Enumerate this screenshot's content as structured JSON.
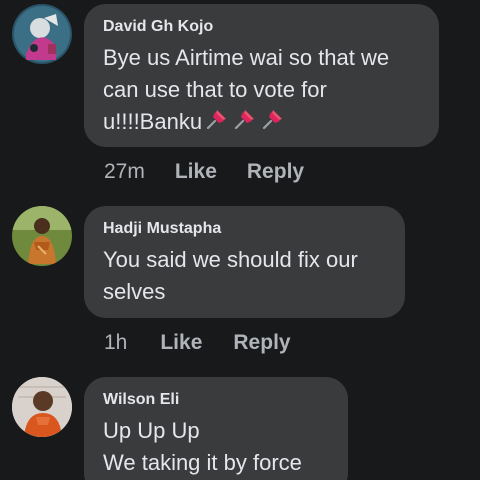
{
  "comments": [
    {
      "author": "David Gh Kojo",
      "lines": [
        "Bye us Airtime wai so that we",
        "can use that to vote for",
        "u!!!!Banku"
      ],
      "emoji": [
        "pushpin-icon",
        "pushpin-icon",
        "pushpin-icon"
      ],
      "time": "27m",
      "like_label": "Like",
      "reply_label": "Reply"
    },
    {
      "author": "Hadji Mustapha",
      "lines": [
        "You said we should fix our",
        "selves"
      ],
      "time": "1h",
      "like_label": "Like",
      "reply_label": "Reply"
    },
    {
      "author": "Wilson Eli",
      "lines": [
        "Up Up Up",
        "We taking it by force"
      ]
    }
  ],
  "colors": {
    "background": "#18191a",
    "bubble": "#3a3b3c",
    "text_primary": "#e4e6eb",
    "text_secondary": "#b0b3b8"
  }
}
